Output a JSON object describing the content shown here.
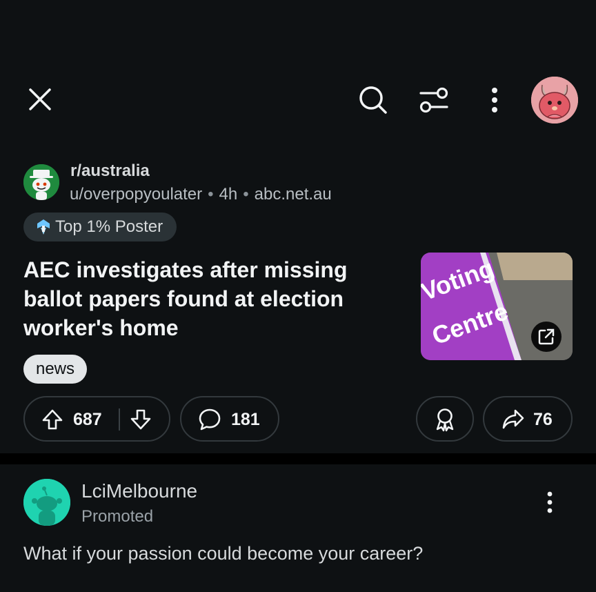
{
  "topbar": {
    "close_icon": "close-icon",
    "search_icon": "search-icon",
    "filter_icon": "sliders-icon",
    "more_icon": "more-vertical-icon"
  },
  "post": {
    "subreddit": "r/australia",
    "author": "u/overpopyoulater",
    "age": "4h",
    "domain": "abc.net.au",
    "user_flair": "Top 1% Poster",
    "title": "AEC investigates after missing ballot papers found at election worker's home",
    "thumbnail_text_line1": "Voting",
    "thumbnail_text_line2": "Centre",
    "post_flair": "news",
    "upvotes": "687",
    "comments": "181",
    "shares": "76"
  },
  "promoted": {
    "advertiser": "LciMelbourne",
    "label": "Promoted",
    "body": "What if your passion could become your career?"
  },
  "colors": {
    "background": "#0e1113",
    "accent_teal": "#1fd3b0",
    "thumbnail_purple": "#a23fc4"
  }
}
